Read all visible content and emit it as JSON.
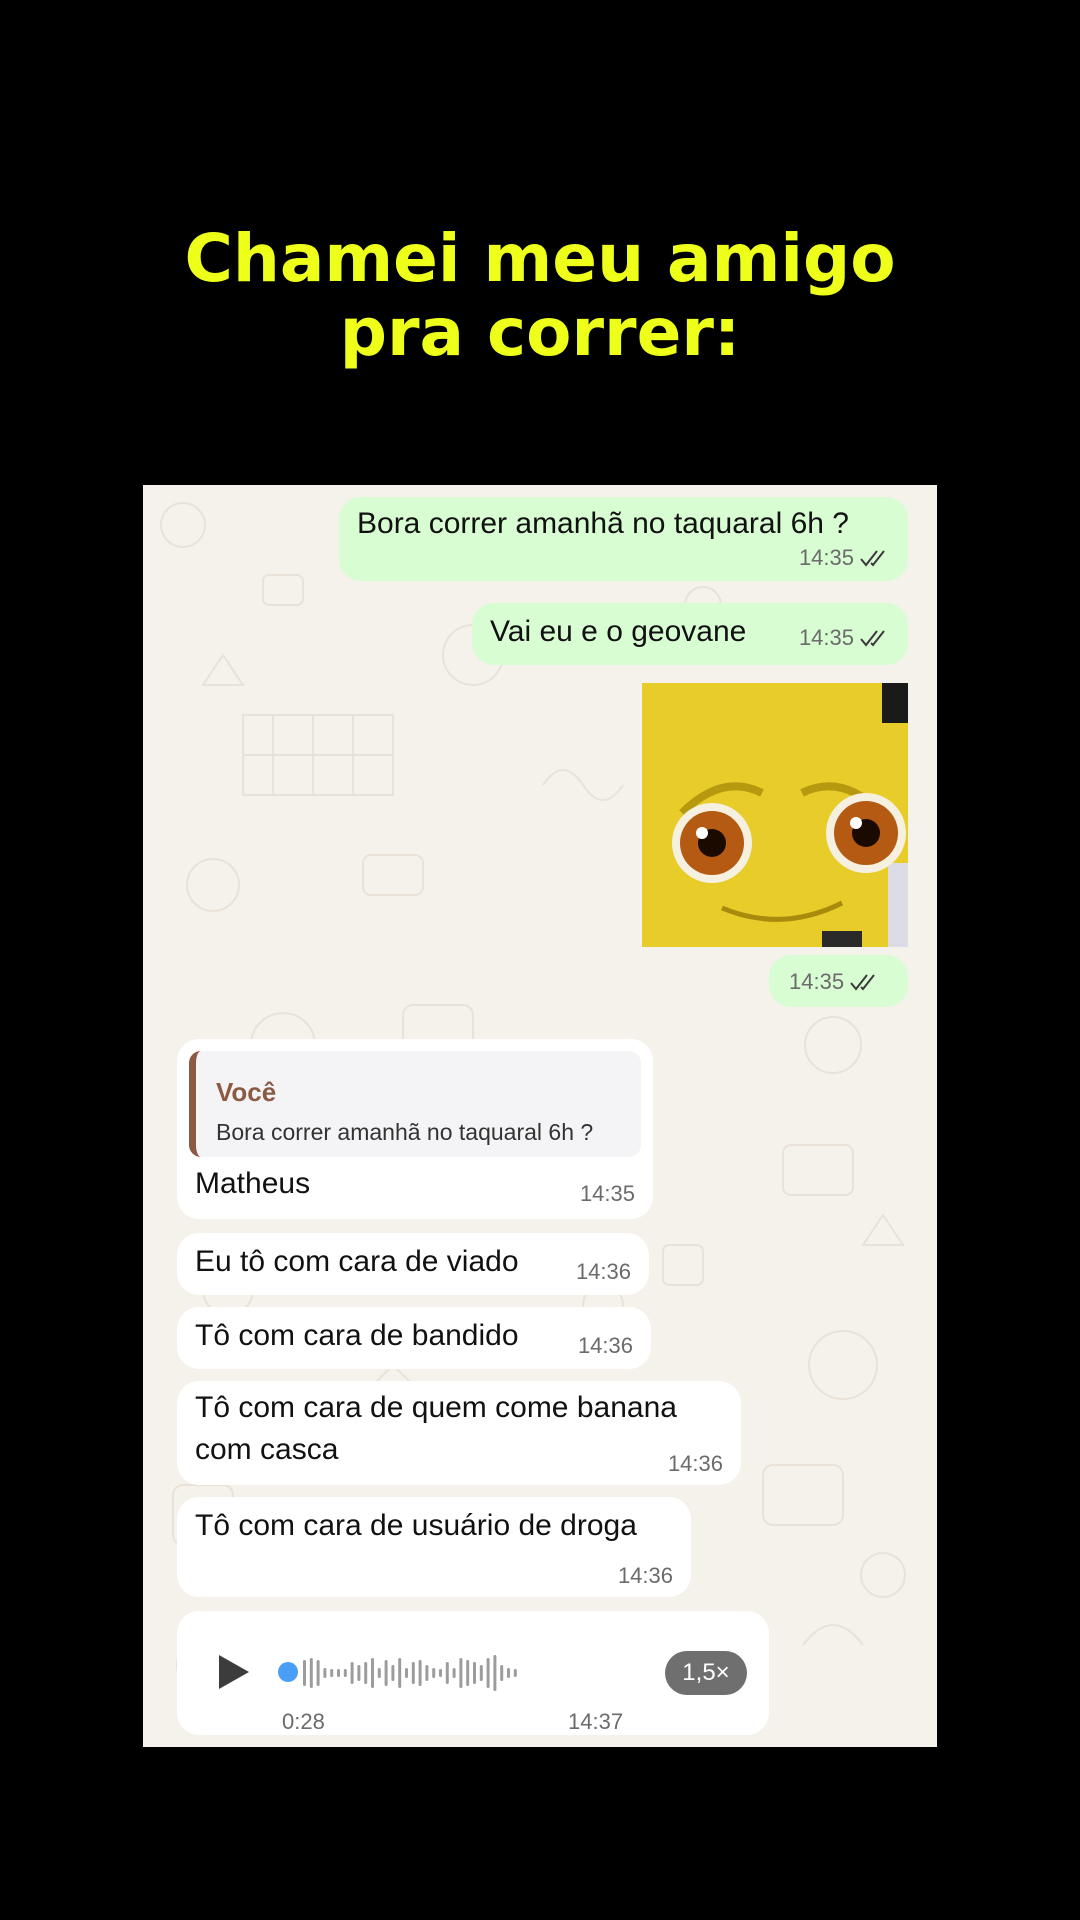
{
  "headline": {
    "line1": "Chamei meu amigo",
    "line2": "pra correr:"
  },
  "colors": {
    "headline": "#EEFF1A",
    "outgoing_bubble": "#D9FDD3",
    "incoming_bubble": "#FFFFFF",
    "chat_background": "#F5F1EB",
    "quote_accent": "#8A5A44",
    "voice_dot": "#4A9FF5"
  },
  "messages": {
    "m1": {
      "text": "Bora correr amanhã no taquaral 6h ?",
      "time": "14:35",
      "status": "read-double-check-icon"
    },
    "m2": {
      "text": "Vai eu e o geovane",
      "time": "14:35",
      "status": "read-double-check-icon"
    },
    "m3": {
      "type": "image",
      "time": "14:35",
      "status": "read-double-check-icon"
    },
    "m4": {
      "quote_author": "Você",
      "quote_text": "Bora correr amanhã no taquaral 6h ?",
      "text": "Matheus",
      "time": "14:35"
    },
    "m5": {
      "text": "Eu tô com cara de viado",
      "time": "14:36"
    },
    "m6": {
      "text": "Tô com cara de bandido",
      "time": "14:36"
    },
    "m7": {
      "line1": "Tô com cara de quem come banana",
      "line2": "com casca",
      "time": "14:36"
    },
    "m8": {
      "text": "Tô com cara de usuário de droga",
      "time": "14:36"
    },
    "voice": {
      "duration": "0:28",
      "time": "14:37",
      "speed": "1,5×",
      "progress": 0
    }
  }
}
